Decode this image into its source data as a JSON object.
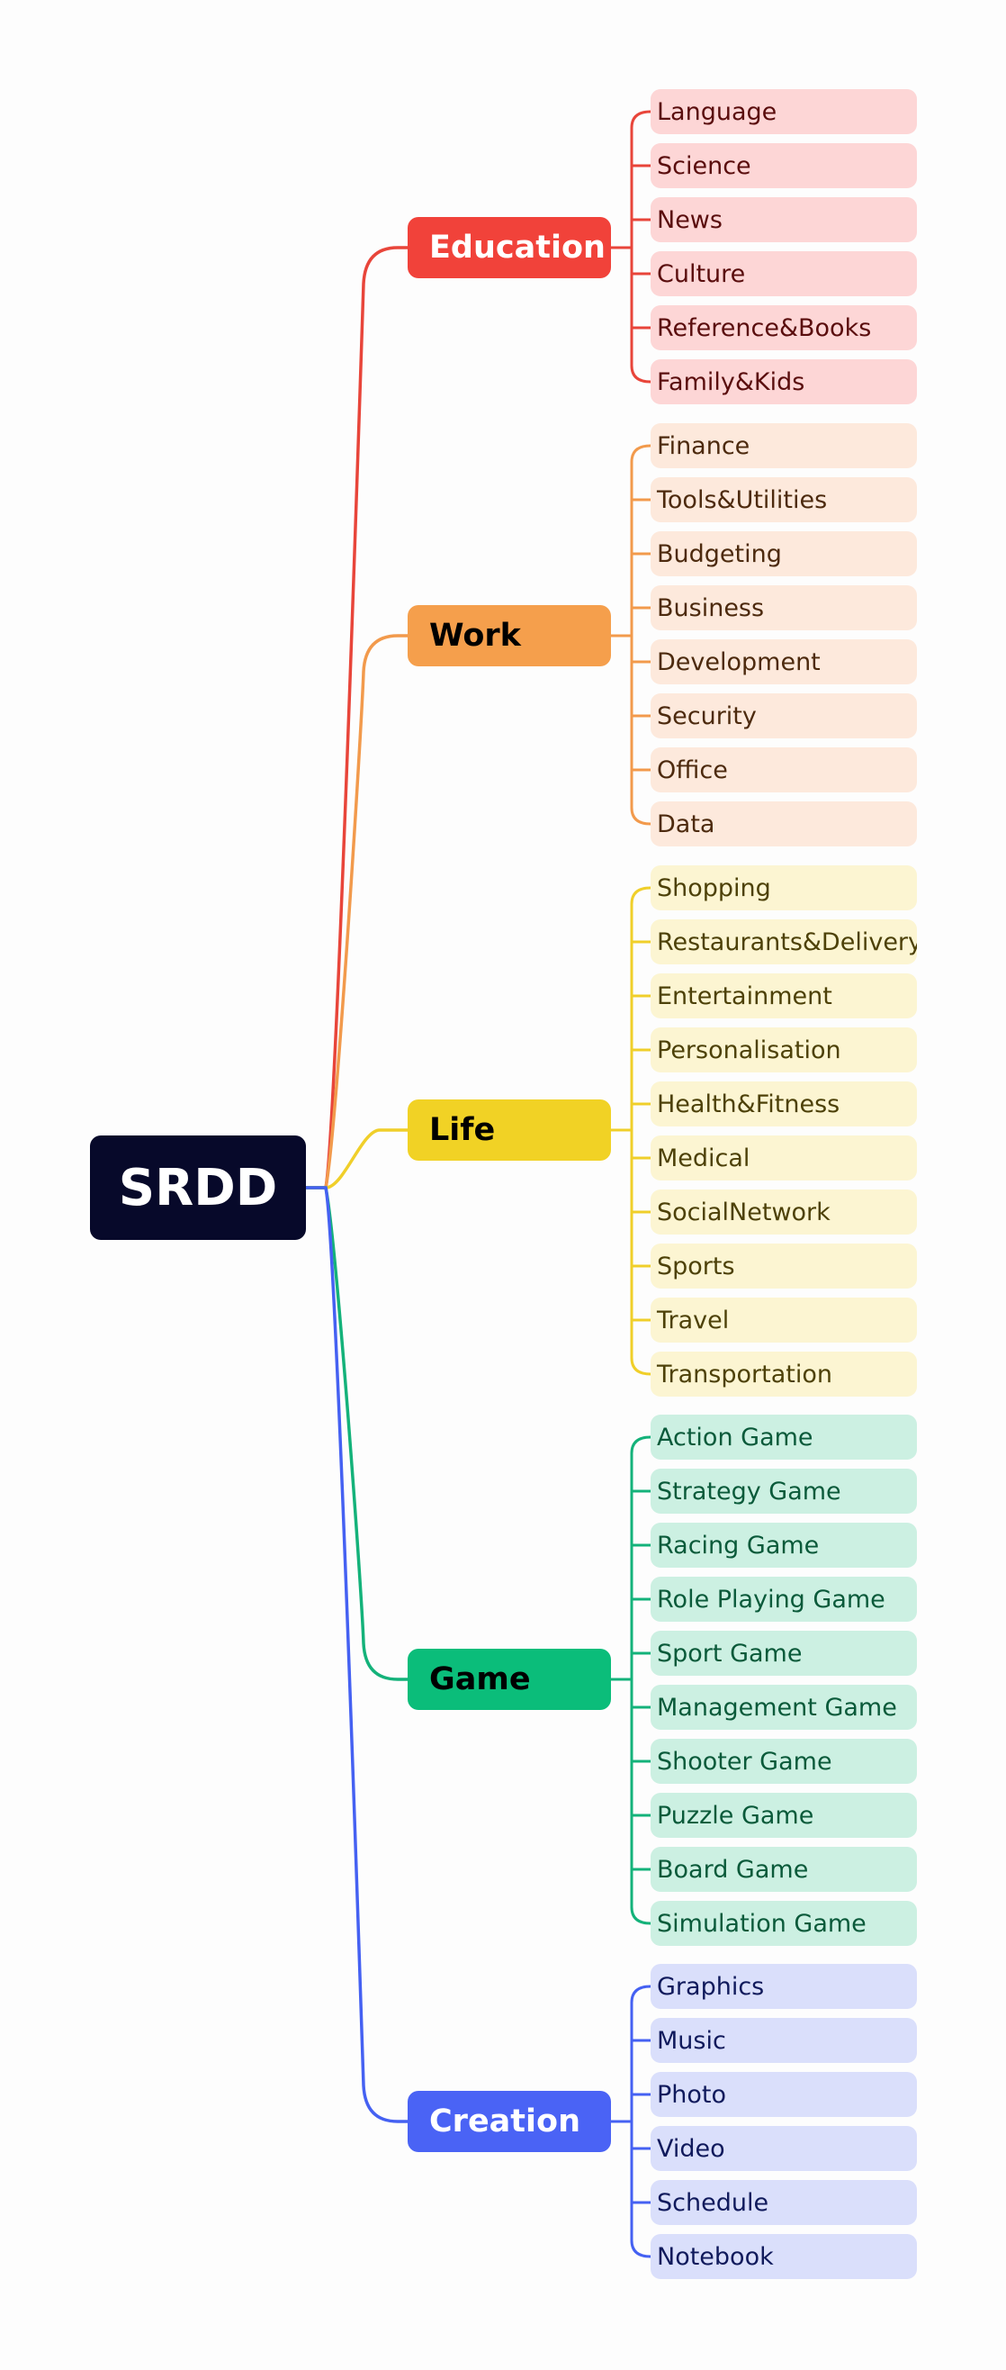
{
  "root": {
    "label": "SRDD",
    "color": "#07092a"
  },
  "categories": [
    {
      "label": "Education",
      "line_color": "#e8453a",
      "box_color": "#f1423a",
      "text_color": "#ffffff",
      "leaf_bg": "#fdd6d6",
      "leaf_text": "#5a0d0d",
      "leaves": [
        "Language",
        "Science",
        "News",
        "Culture",
        "Reference&Books",
        "Family&Kids"
      ]
    },
    {
      "label": "Work",
      "line_color": "#f29a4c",
      "box_color": "#f59f4c",
      "text_color": "#000000",
      "leaf_bg": "#fde9dc",
      "leaf_text": "#4d2a0e",
      "leaves": [
        "Finance",
        "Tools&Utilities",
        "Budgeting",
        "Business",
        "Development",
        "Security",
        "Office",
        "Data"
      ]
    },
    {
      "label": "Life",
      "line_color": "#f0cf2a",
      "box_color": "#f1d225",
      "text_color": "#000000",
      "leaf_bg": "#fcf5d2",
      "leaf_text": "#4d4108",
      "leaves": [
        "Shopping",
        "Restaurants&Delivery",
        "Entertainment",
        "Personalisation",
        "Health&Fitness",
        "Medical",
        "SocialNetwork",
        "Sports",
        "Travel",
        "Transportation"
      ]
    },
    {
      "label": "Game",
      "line_color": "#14b27a",
      "box_color": "#0bbd7a",
      "text_color": "#000000",
      "leaf_bg": "#ccf0e2",
      "leaf_text": "#0a5a3a",
      "leaves": [
        "Action Game",
        "Strategy Game",
        "Racing Game",
        "Role Playing Game",
        "Sport Game",
        "Management Game",
        "Shooter Game",
        "Puzzle Game",
        "Board Game",
        "Simulation Game"
      ]
    },
    {
      "label": "Creation",
      "line_color": "#4561f2",
      "box_color": "#4a63f5",
      "text_color": "#ffffff",
      "leaf_bg": "#dadffb",
      "leaf_text": "#101a5c",
      "leaves": [
        "Graphics",
        "Music",
        "Photo",
        "Video",
        "Schedule",
        "Notebook"
      ]
    }
  ]
}
